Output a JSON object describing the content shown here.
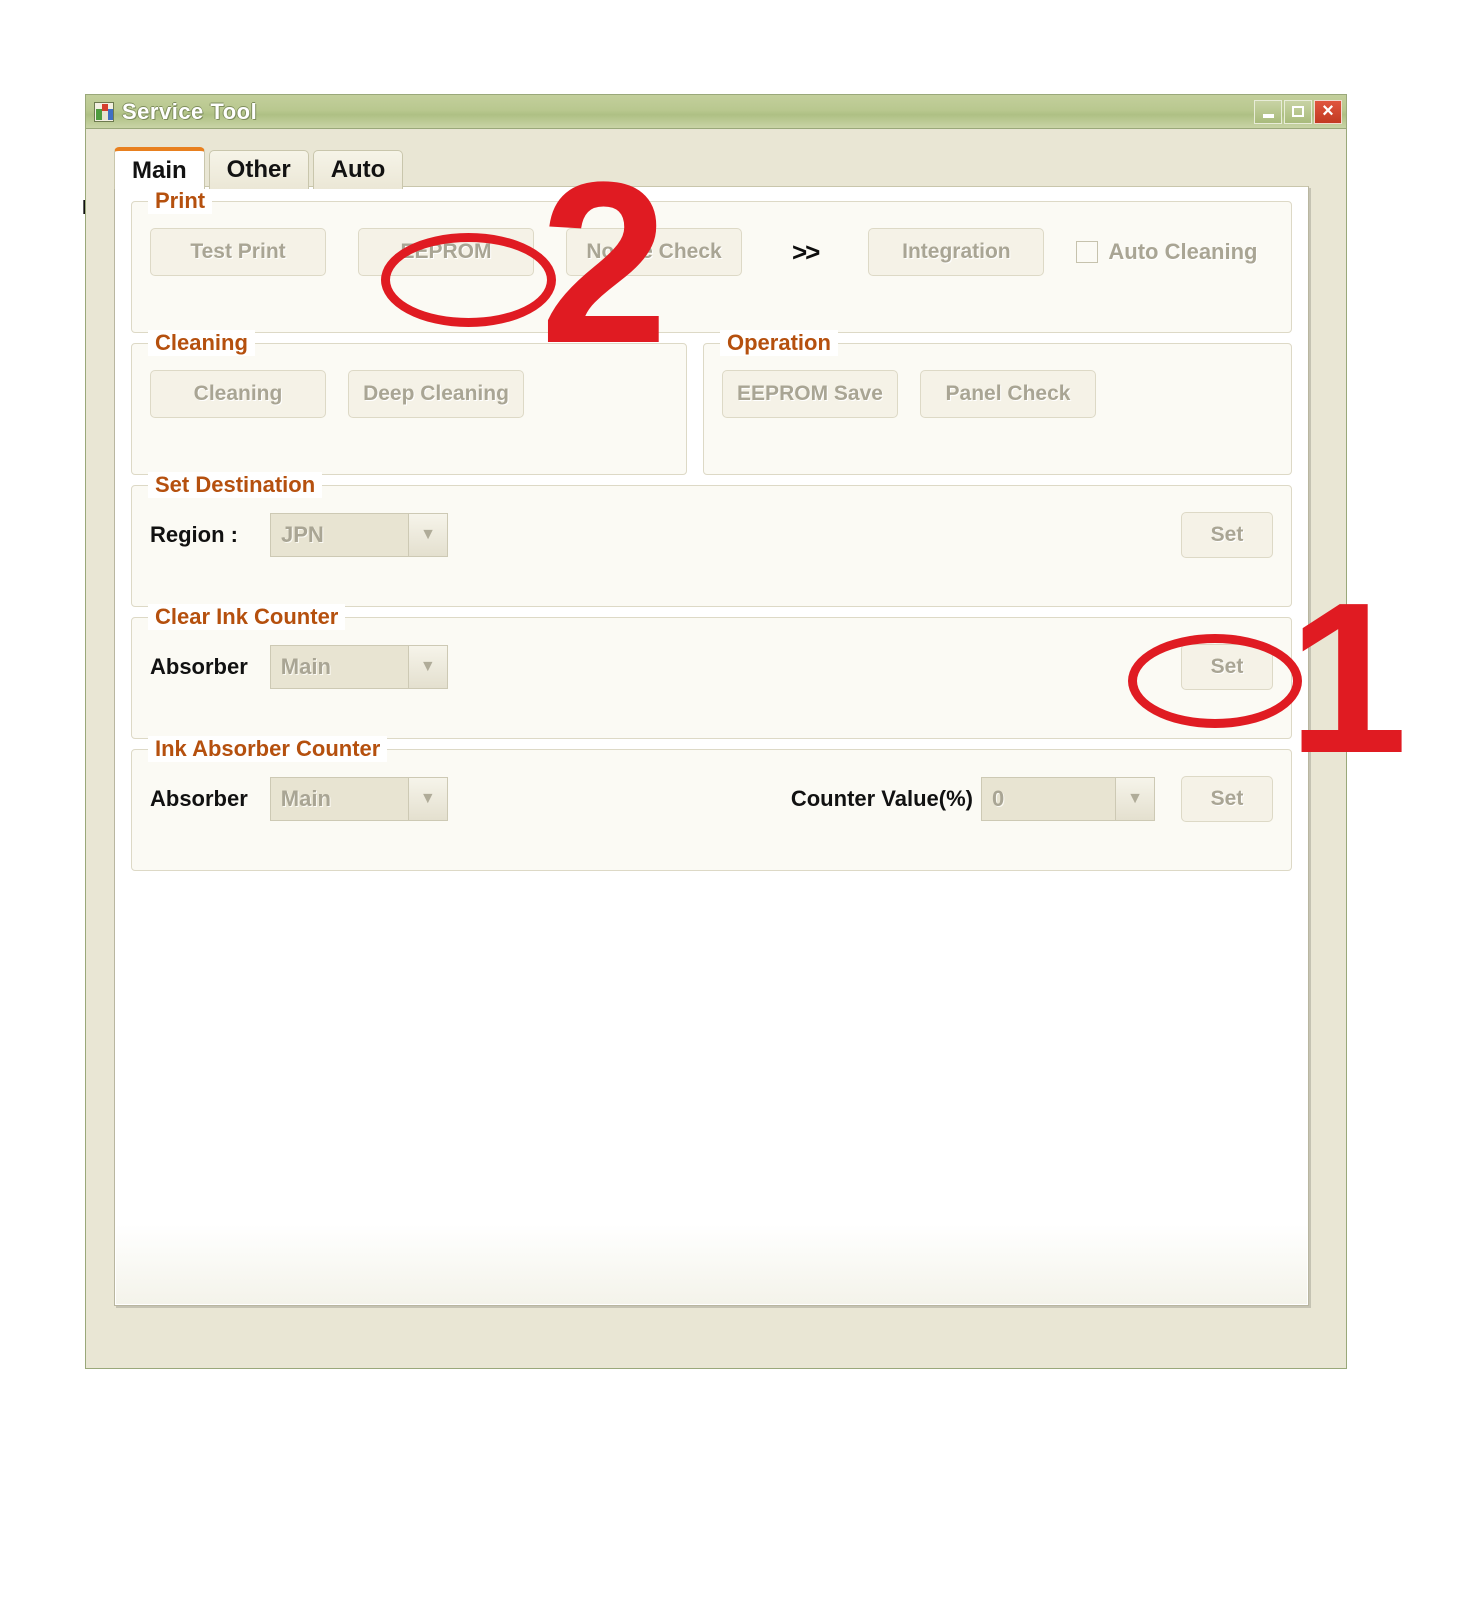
{
  "window": {
    "title": "Service Tool",
    "icon": "app-grid-icon",
    "controls": {
      "minimize": "minimize-icon",
      "maximize": "maximize-icon",
      "close": "×"
    }
  },
  "tabs": [
    {
      "label": "Main",
      "active": true
    },
    {
      "label": "Other",
      "active": false
    },
    {
      "label": "Auto",
      "active": false
    }
  ],
  "groups": {
    "print": {
      "legend": "Print",
      "buttons": [
        {
          "label": "Test Print"
        },
        {
          "label": "EEPROM"
        },
        {
          "label": "Nozzle Check"
        }
      ],
      "separator": ">>",
      "integration": "Integration",
      "auto_cleaning": {
        "label": "Auto Cleaning",
        "checked": false
      }
    },
    "cleaning": {
      "legend": "Cleaning",
      "buttons": [
        {
          "label": "Cleaning"
        },
        {
          "label": "Deep Cleaning"
        }
      ]
    },
    "operation": {
      "legend": "Operation",
      "buttons": [
        {
          "label": "EEPROM Save"
        },
        {
          "label": "Panel Check"
        }
      ]
    },
    "set_destination": {
      "legend": "Set Destination",
      "region_label": "Region :",
      "region_value": "JPN",
      "set_label": "Set"
    },
    "clear_ink_counter": {
      "legend": "Clear Ink Counter",
      "absorber_label": "Absorber",
      "absorber_value": "Main",
      "set_label": "Set"
    },
    "ink_absorber_counter": {
      "legend": "Ink Absorber Counter",
      "absorber_label": "Absorber",
      "absorber_value": "Main",
      "counter_label": "Counter Value(%)",
      "counter_value": "0",
      "set_label": "Set"
    }
  },
  "annotations": [
    {
      "number": "1",
      "target": "clear-ink-counter-set-button",
      "color": "#e01b22"
    },
    {
      "number": "2",
      "target": "eeprom-button",
      "color": "#e01b22"
    }
  ],
  "backdrop": {
    "fragment": "h"
  }
}
